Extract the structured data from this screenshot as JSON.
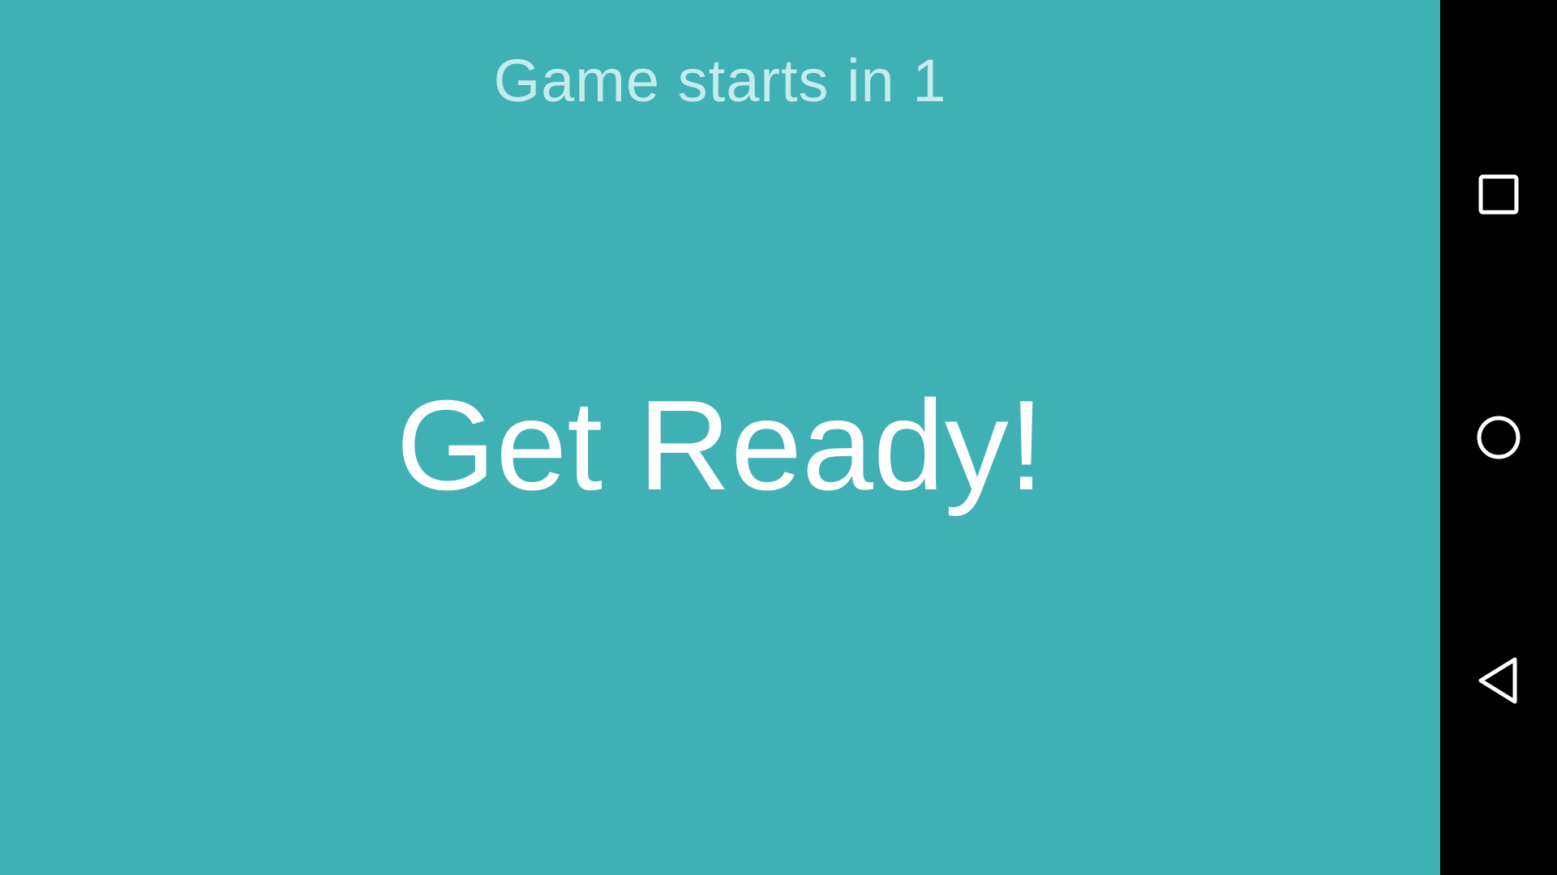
{
  "screen": {
    "countdown_text": "Game starts in 1",
    "headline": "Get Ready!"
  },
  "colors": {
    "background": "#3fb0b4",
    "countdown_text": "#c5ecec",
    "headline_text": "#ffffff",
    "nav_bar": "#000000",
    "nav_icons": "#ffffff"
  },
  "nav_bar": {
    "buttons": [
      {
        "name": "recents",
        "icon": "square-icon"
      },
      {
        "name": "home",
        "icon": "circle-icon"
      },
      {
        "name": "back",
        "icon": "triangle-back-icon"
      }
    ]
  }
}
